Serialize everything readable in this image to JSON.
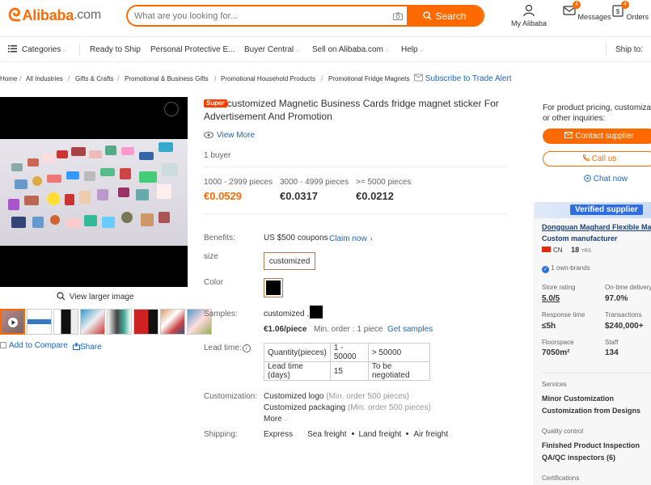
{
  "header": {
    "logo_text": "Alibaba",
    "logo_suffix": ".com",
    "search_placeholder": "What are you looking for...",
    "search_button": "Search",
    "my_alibaba": "My Alibaba",
    "messages": "Messages",
    "messages_count": "4",
    "orders": "Orders",
    "orders_count": "4"
  },
  "nav": {
    "categories": "Categories",
    "ready_to_ship": "Ready to Ship",
    "ppe": "Personal Protective E...",
    "buyer_central": "Buyer Central",
    "sell": "Sell on Alibaba.com",
    "help": "Help",
    "ship_to": "Ship to:"
  },
  "breadcrumb": {
    "items": [
      "Home",
      "All Industries",
      "Gifts & Crafts",
      "Promotional & Business Gifts",
      "Promotional Household Products",
      "Promotional Fridge Magnets"
    ],
    "subscribe": "Subscribe to Trade Alert"
  },
  "gallery": {
    "view_larger": "View larger image",
    "compare": "Add to Compare",
    "share": "Share"
  },
  "product": {
    "super_badge": "Super",
    "title": "customized Magnetic Business Cards fridge magnet sticker For Advertisement And Promotion",
    "view_more": "View More",
    "buyers": "1 buyer",
    "tiers": [
      {
        "range": "1000 - 2999 pieces",
        "price": "€0.0529"
      },
      {
        "range": "3000 - 4999 pieces",
        "price": "€0.0317"
      },
      {
        "range": ">= 5000 pieces",
        "price": "€0.0212"
      }
    ],
    "benefits_label": "Benefits:",
    "benefits_value": "US $500 coupons",
    "claim_now": "Claim now",
    "size_label": "size",
    "size_option": "customized",
    "color_label": "Color",
    "color_swatch": "#000000",
    "samples_label": "Samples:",
    "samples_value": "customized ,",
    "sample_price": "€1.06/piece",
    "min_order": "Min. order : 1 piece",
    "get_samples": "Get samples",
    "lead_label": "Lead time:",
    "lead_table": {
      "headers": [
        "Quantity(pieces)",
        "1 - 50000",
        "> 50000"
      ],
      "row": [
        "Lead time (days)",
        "15",
        "To be negotiated"
      ]
    },
    "customization_label": "Customization:",
    "custom_logo": "Customized logo",
    "custom_logo_note": "(Min. order 500 pieces)",
    "custom_packaging": "Customized packaging",
    "custom_packaging_note": "(Min. order 500 pieces)",
    "more": "More",
    "shipping_label": "Shipping:",
    "shipping_options": [
      "Express",
      "Sea freight",
      "Land freight",
      "Air freight"
    ]
  },
  "side": {
    "inquiry_text_1": "For product pricing, customizatio",
    "inquiry_text_2": "or other inquiries:",
    "contact_supplier": "Contact supplier",
    "call_us": "Call us",
    "chat_now": "Chat now",
    "verified": "Verified supplier",
    "supplier_name": "Dongguan Maghard Flexible Magnet C",
    "custom_manufacturer": "Custom manufacturer",
    "country": "CN",
    "years": "18",
    "years_unit": "YRS",
    "own_brands": "1 own-brands",
    "store_rating_label": "Store rating",
    "store_rating": "5.0/5",
    "ontime_label": "On-time delivery",
    "ontime": "97.0%",
    "response_label": "Response time",
    "response": "≤5h",
    "transactions_label": "Transactions",
    "transactions": "$240,000+",
    "floor_label": "Floorspace",
    "floor": "7050m²",
    "staff_label": "Staff",
    "staff": "134",
    "services_label": "Services",
    "service_1": "Minor Customization",
    "service_2": "Customization from Designs",
    "qc_label": "Quality control",
    "qc_1": "Finished Product Inspection",
    "qc_2": "QA/QC inspectors (6)",
    "certifications_label": "Certifications"
  },
  "colors": {
    "accent": "#ff6a00",
    "price": "#ff6a00",
    "link": "#1a66c2",
    "verified": "#2e6ee3"
  }
}
